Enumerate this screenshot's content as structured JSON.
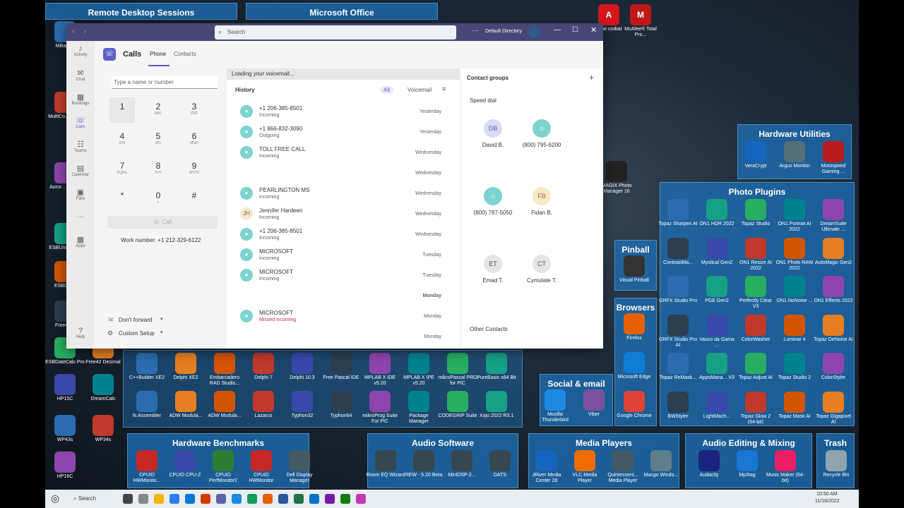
{
  "desktop": {
    "top_fences": [
      "Remote Desktop Sessions",
      "Microsoft Office"
    ],
    "top_right_icons": [
      "dobe crobat",
      "McAfee® Total Pro..."
    ],
    "fences": {
      "hardware_utilities": "Hardware Utilities",
      "photo_plugins": "Photo Plugins",
      "pinball": "Pinball",
      "browsers": "Browsers",
      "social": "Social & email",
      "benchmarks": "Hardware Benchmarks",
      "audio_software": "Audio Software",
      "media_players": "Media Players",
      "audio_editing": "Audio Editing & Mixing",
      "trash": "Trash"
    },
    "hardware_utilities_icons": [
      "VeraCrypt",
      "Argus Monitor",
      "Motospeed Gaming ..."
    ],
    "photo_icons": [
      "Topaz Sharpen AI",
      "ON1 HDR 2022",
      "Topaz Studio",
      "ON1 Portrait AI 2022",
      "DreamSuite Ultimate ...",
      "ContrastMa...",
      "Mystical Gen2",
      "ON1 Resize AI 2022",
      "ON1 Photo RAW 2022",
      "AutoMagic Gen2",
      "GRFX Studio Pro",
      "PGE Gen2",
      "Perfectly Clear V3",
      "ON1 NoNoise ...",
      "ON1 Effects 2022",
      "GRFX Studio Pro AI",
      "Vasco da Gama ...",
      "ColorWasher",
      "Luminar 4",
      "Topaz DeNoise AI",
      "Topaz ReMask...",
      "AppsMana... V3",
      "Topaz Adjust AI",
      "Topaz Studio 2",
      "ColorStyler",
      "BWStyler",
      "LightMach...",
      "Topaz Glow 2 (64-bit)",
      "Topaz Mask AI",
      "Topaz Gigapixel AI"
    ],
    "browser_icons": [
      "Firefox",
      "Microsoft Edge",
      "Google Chrome"
    ],
    "social_icons": [
      "Mozilla Thunderbird",
      "Viber"
    ],
    "pinball_icons": [
      "Visual Pinball"
    ],
    "magix": "MAGIX Photo Manager 16",
    "left_icons": [
      "MBaro...",
      "MultiCo... (x64)",
      "Auror... Text &",
      "ESBUnit... Pro",
      "ESBCal...",
      "Free42...",
      "ESBDateCalc Pro",
      "Free42 Decimal",
      "HP15C",
      "DreamCalc",
      "WP43s",
      "WP34s",
      "HP16C"
    ],
    "dev_icons": [
      "C++Builder XE2",
      "Delphi XE2",
      "Embarcadero RAD Studio...",
      "Delphi 7",
      "Delphi 10.3",
      "Free Pascal IDE",
      "MPLAB X IDE v5.20",
      "MPLAB X IPE v5.20",
      "mikroPascal PRO for PIC",
      "PureBasic x64 Bit",
      "N.Assembler",
      "ADW Modula...",
      "ADW Modula...",
      "Lazarus",
      "Typhon32",
      "Typhon64",
      "mikroProg Suite For PIC",
      "Package Manager",
      "CODEGRIP Suite",
      "Xojo 2022 R3.1"
    ],
    "bench_icons": [
      "CPUID HWMonito...",
      "CPUID CPU-Z",
      "CPUID PerfMonitor2",
      "CPUID HWMonitor",
      "Dell Display Manager"
    ],
    "audio_sw_icons": [
      "Room EQ Wizard",
      "REW - 5.20 Beta",
      "MiniDSP-2...",
      "DATS"
    ],
    "media_icons": [
      "JRiver Media Center 28",
      "VLC Media Player",
      "Quintessent... Media Player",
      "Macgo Windo..."
    ],
    "audio_edit_icons": [
      "Audacity",
      "Mp3tag",
      "Music Maker (64-bit)"
    ],
    "trash_icons": [
      "Recycle Bin"
    ]
  },
  "teams": {
    "search_placeholder": "Search",
    "directory": "Default Directory",
    "rail": [
      "Activity",
      "Chat",
      "Bookings",
      "Calls",
      "Teams",
      "Calendar",
      "Files",
      "Apps",
      "Help"
    ],
    "app_title": "Calls",
    "tabs": [
      "Phone",
      "Contacts"
    ],
    "dial_placeholder": "Type a name or number",
    "keys": [
      {
        "d": "1",
        "l": ""
      },
      {
        "d": "2",
        "l": "ABC"
      },
      {
        "d": "3",
        "l": "DEF"
      },
      {
        "d": "4",
        "l": "GHI"
      },
      {
        "d": "5",
        "l": "JKL"
      },
      {
        "d": "6",
        "l": "MNO"
      },
      {
        "d": "7",
        "l": "PQRS"
      },
      {
        "d": "8",
        "l": "TUV"
      },
      {
        "d": "9",
        "l": "WXYZ"
      },
      {
        "d": "*",
        "l": ""
      },
      {
        "d": "0",
        "l": "+"
      },
      {
        "d": "#",
        "l": ""
      }
    ],
    "call_button": "Call",
    "work_number": "Work number: +1 212-329-6122",
    "dont_forward": "Don't forward",
    "custom_setup": "Custom Setup",
    "voicemail_banner": "Loading your voicemail...",
    "history_label": "History",
    "filter_all": "All",
    "filter_voicemail": "Voicemail",
    "history": [
      {
        "name": "+1 206-385-8501",
        "sub": "Incoming",
        "day": "Yesterday",
        "initials": ""
      },
      {
        "name": "+1 866-832-3090",
        "sub": "Outgoing",
        "day": "Yesterday",
        "initials": ""
      },
      {
        "name": "TOLL FREE CALL",
        "sub": "Incoming",
        "day": "Wednesday",
        "initials": ""
      },
      {
        "name": "",
        "sub": "",
        "day": "Wednesday",
        "initials": ""
      },
      {
        "name": "PEARLINGTON MS",
        "sub": "Incoming",
        "day": "Wednesday",
        "initials": ""
      },
      {
        "name": "Jennifer Hardeen",
        "sub": "Incoming",
        "day": "Wednesday",
        "initials": "JH"
      },
      {
        "name": "+1 206-385-8501",
        "sub": "Incoming",
        "day": "Wednesday",
        "initials": ""
      },
      {
        "name": "MICROSOFT",
        "sub": "Incoming",
        "day": "Tuesday",
        "initials": ""
      },
      {
        "name": "MICROSOFT",
        "sub": "Incoming",
        "day": "Tuesday",
        "initials": ""
      },
      {
        "name": "",
        "sub": "",
        "day": "Monday",
        "initials": ""
      },
      {
        "name": "MICROSOFT",
        "sub": "Missed incoming",
        "day": "Monday",
        "initials": ""
      },
      {
        "name": "",
        "sub": "",
        "day": "Monday",
        "initials": ""
      }
    ],
    "contact_groups": "Contact groups",
    "speed_dial": "Speed dial",
    "speed_dial_items": [
      {
        "initials": "DB",
        "name": "David B."
      },
      {
        "initials": "",
        "name": "(800) 795-6200"
      },
      {
        "initials": "",
        "name": "(800) 787-5050"
      },
      {
        "initials": "FB",
        "name": "Fidan B."
      },
      {
        "initials": "ET",
        "name": "Emad T."
      },
      {
        "initials": "CT",
        "name": "Cymulate T."
      }
    ],
    "other_contacts": "Other Contacts"
  },
  "taskbar": {
    "search": "Search",
    "time": "10:50 AM",
    "date": "11/18/2022"
  }
}
